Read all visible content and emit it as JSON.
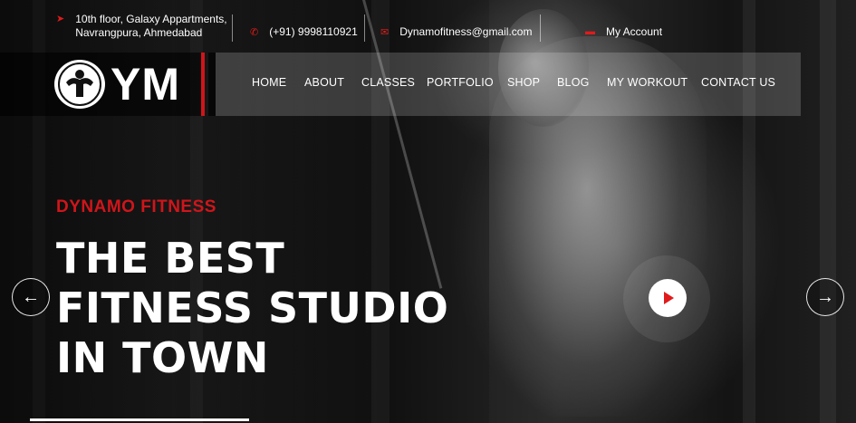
{
  "topbar": {
    "address_line1": "10th floor, Galaxy Appartments,",
    "address_line2": "Navrangpura, Ahmedabad",
    "phone": "(+91) 9998110921",
    "email": "Dynamofitness@gmail.com",
    "account": "My Account",
    "icons": {
      "address": "location-arrow-icon",
      "phone": "phone-icon",
      "email": "envelope-icon",
      "account": "user-icon"
    }
  },
  "brand": {
    "logo_text": "YM",
    "accent_color": "#d0151a"
  },
  "nav": {
    "items": [
      "HOME",
      "ABOUT",
      "CLASSES",
      "PORTFOLIO",
      "SHOP",
      "BLOG",
      "MY WORKOUT",
      "CONTACT US"
    ]
  },
  "hero": {
    "eyebrow": "DYNAMO FITNESS",
    "headline_line1": "THE BEST",
    "headline_line2": "FITNESS STUDIO",
    "headline_line3": "IN TOWN"
  },
  "carousel": {
    "prev_icon": "arrow-left-icon",
    "next_icon": "arrow-right-icon",
    "play_icon": "play-icon"
  }
}
